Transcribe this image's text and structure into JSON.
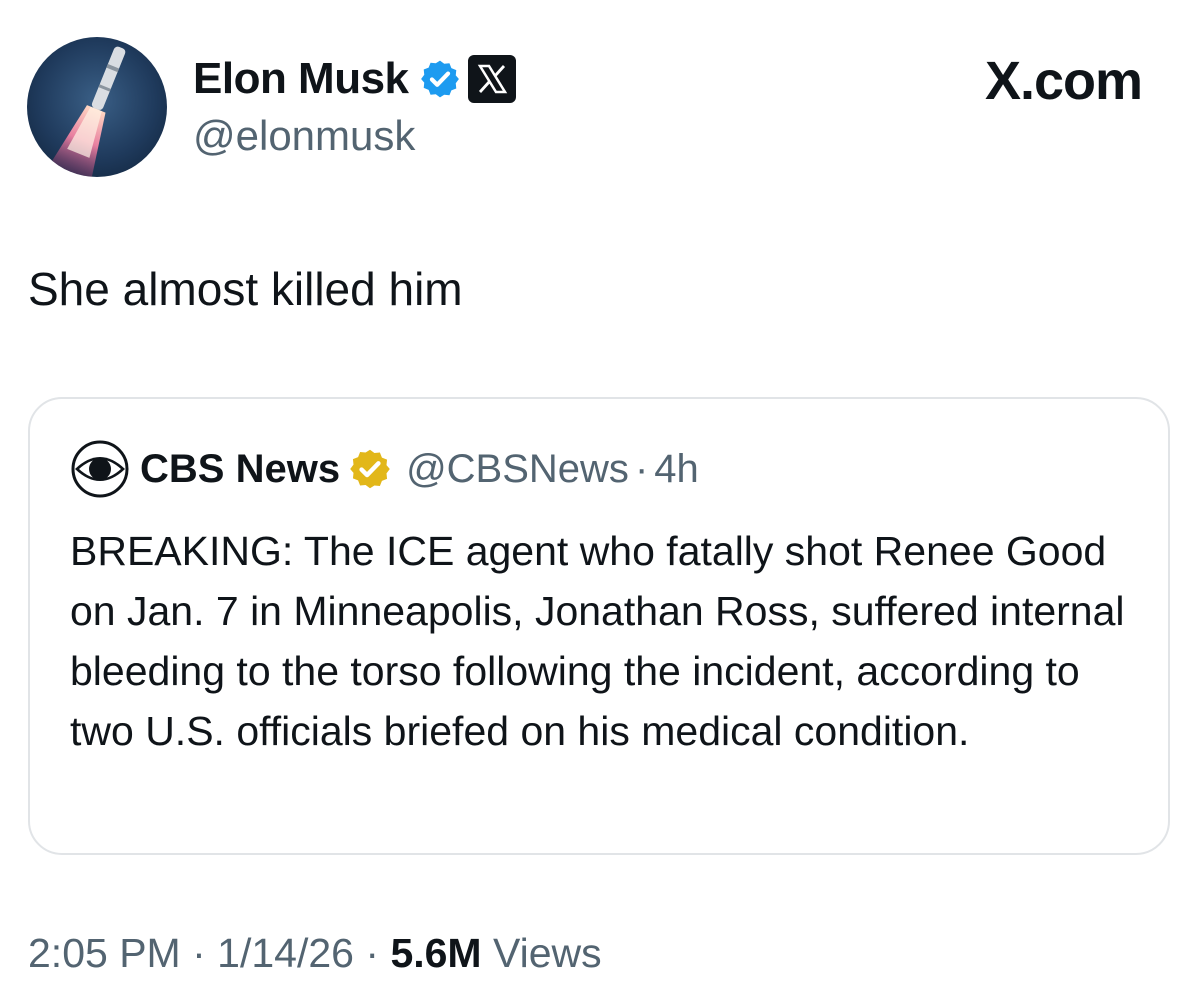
{
  "author": {
    "name": "Elon Musk",
    "handle": "@elonmusk",
    "verified_badge_color": "#1d9bf0",
    "affiliate_badge": "x-logo-icon"
  },
  "brand": {
    "label": "X.com"
  },
  "tweet": {
    "text": "She almost killed him"
  },
  "quoted_tweet": {
    "name": "CBS News",
    "handle": "@CBSNews",
    "separator": "·",
    "time": "4h",
    "verified_badge_color": "#e2b719",
    "logo": "cbs-eye-icon",
    "text": "BREAKING: The ICE agent who fatally shot Renee Good on Jan. 7 in Minneapolis, Jonathan Ross, suffered internal bleeding to the torso following the incident, according to two U.S. officials briefed on his medical condition."
  },
  "meta": {
    "time": "2:05 PM",
    "separator1": "·",
    "date": "1/14/26",
    "separator2": "·",
    "views_count": "5.6M",
    "views_label": "Views"
  },
  "colors": {
    "text_primary": "#0f1419",
    "text_secondary": "#536471",
    "border": "#e1e4e7"
  }
}
